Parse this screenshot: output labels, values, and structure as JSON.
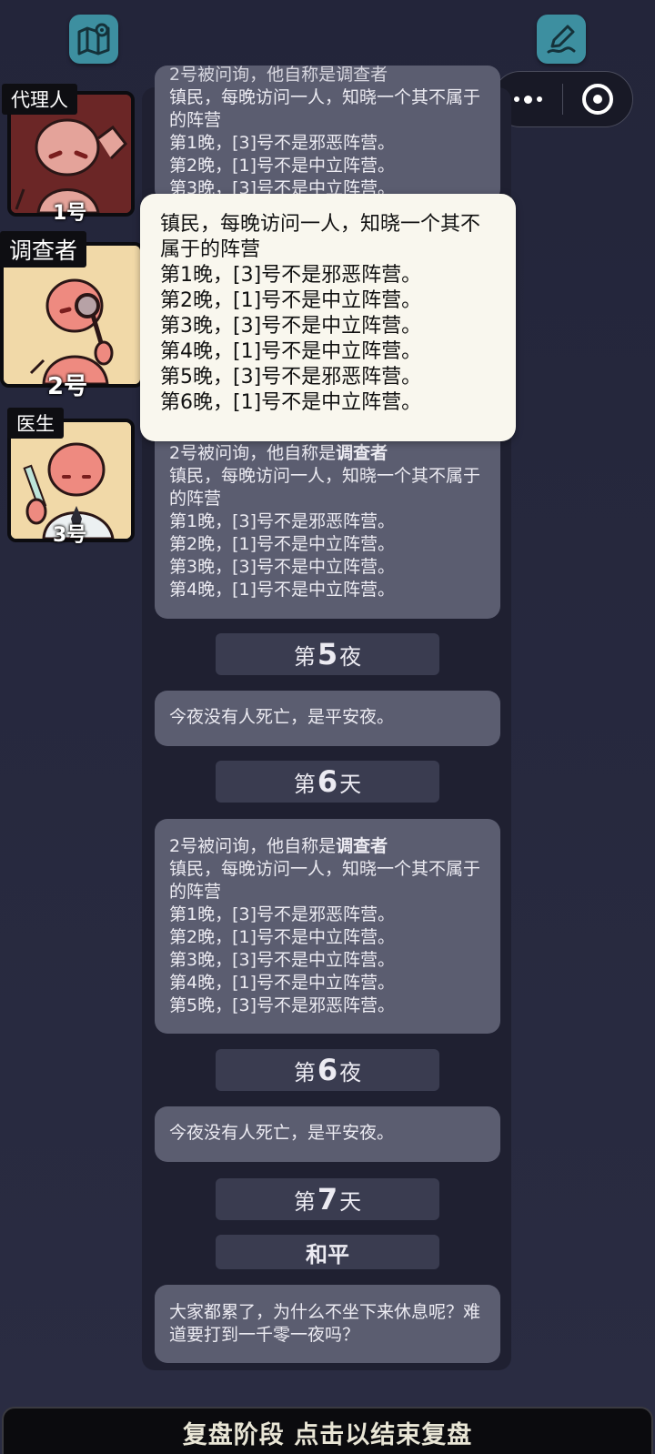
{
  "top_icons": {
    "left": "map-pin-icon",
    "right": "pen-icon"
  },
  "capsule": {
    "more": "more-dots-icon",
    "close": "target-icon"
  },
  "players": [
    {
      "role": "代理人",
      "number": "1号"
    },
    {
      "role": "调查者",
      "number": "2号"
    },
    {
      "role": "医生",
      "number": "3号"
    }
  ],
  "tooltip": {
    "line1": "镇民，每晚访问一人，知晓一个其不属于的阵营",
    "line2": "第1晚，[3]号不是邪恶阵营。",
    "line3": "第2晚，[1]号不是中立阵营。",
    "line4": "第3晚，[3]号不是中立阵营。",
    "line5": "第4晚，[1]号不是中立阵营。",
    "line6": "第5晚，[3]号不是邪恶阵营。",
    "line7": "第6晚，[1]号不是中立阵营。"
  },
  "log": {
    "top_msg": {
      "line0": "2号被问询，他自称是调查者",
      "line1": "镇民，每晚访问一人，知晓一个其不属于的阵营",
      "line2": "第1晚，[3]号不是邪恶阵营。",
      "line3": "第2晚，[1]号不是中立阵营。",
      "line4": "第3晚，[3]号不是中立阵营。"
    },
    "msg_day5": {
      "prefix": "2号被问询，他自称是",
      "role": "调查者",
      "line1": "镇民，每晚访问一人，知晓一个其不属于的阵营",
      "line2": "第1晚，[3]号不是邪恶阵营。",
      "line3": "第2晚，[1]号不是中立阵营。",
      "line4": "第3晚，[3]号不是中立阵营。",
      "line5": "第4晚，[1]号不是中立阵营。"
    },
    "night5": {
      "pre": "第",
      "num": "5",
      "post": "夜"
    },
    "night5_msg": "今夜没有人死亡，是平安夜。",
    "day6": {
      "pre": "第",
      "num": "6",
      "post": "天"
    },
    "msg_day6": {
      "prefix": "2号被问询，他自称是",
      "role": "调查者",
      "line1": "镇民，每晚访问一人，知晓一个其不属于的阵营",
      "line2": "第1晚，[3]号不是邪恶阵营。",
      "line3": "第2晚，[1]号不是中立阵营。",
      "line4": "第3晚，[3]号不是中立阵营。",
      "line5": "第4晚，[1]号不是中立阵营。",
      "line6": "第5晚，[3]号不是邪恶阵营。"
    },
    "night6": {
      "pre": "第",
      "num": "6",
      "post": "夜"
    },
    "night6_msg": "今夜没有人死亡，是平安夜。",
    "day7": {
      "pre": "第",
      "num": "7",
      "post": "天"
    },
    "peace_label": "和平",
    "final_msg": "大家都累了，为什么不坐下来休息呢？难道要打到一千零一夜吗？"
  },
  "bottom_bar": {
    "label": "复盘阶段 点击以结束复盘"
  }
}
